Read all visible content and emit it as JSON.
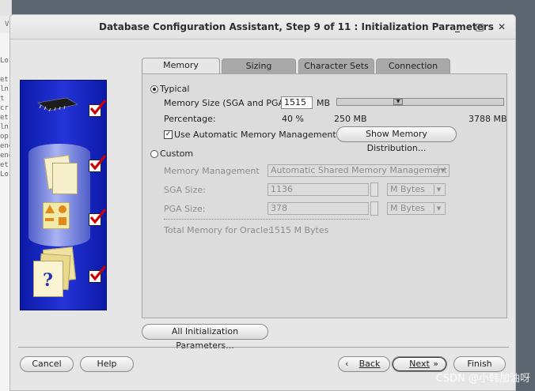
{
  "background_terminal": {
    "lines": [
      "et",
      "ln",
      "t",
      "cr",
      "et",
      "ln",
      "op",
      "ene",
      "ene",
      "et",
      "Lo"
    ],
    "top_labels": [
      "V",
      "Lo"
    ]
  },
  "window": {
    "title": "Database Configuration Assistant, Step 9 of 11 : Initialization Parameters",
    "minimize": "_",
    "maximize": "□",
    "close": "✕"
  },
  "tabs": [
    {
      "label": "Memory",
      "active": true
    },
    {
      "label": "Sizing",
      "active": false
    },
    {
      "label": "Character Sets",
      "active": false
    },
    {
      "label": "Connection Mode",
      "active": false
    }
  ],
  "memory": {
    "typical_label": "Typical",
    "typical_selected": true,
    "memory_size_label": "Memory Size (SGA and PGA):",
    "memory_size_value": "1515",
    "memory_size_unit": "MB",
    "percentage_label": "Percentage:",
    "percentage_value": "40 %",
    "slider_min": "250 MB",
    "slider_max": "3788 MB",
    "slider_fraction": 0.36,
    "use_amm_label": "Use Automatic Memory Management",
    "use_amm_checked": true,
    "show_distribution_button": "Show Memory Distribution...",
    "custom_label": "Custom",
    "custom_selected": false,
    "memory_management_label": "Memory Management",
    "memory_management_value": "Automatic Shared Memory Management",
    "sga_label": "SGA Size:",
    "sga_value": "1136",
    "sga_unit": "M Bytes",
    "pga_label": "PGA Size:",
    "pga_value": "378",
    "pga_unit": "M Bytes",
    "total_label": "Total Memory for Oracle:",
    "total_value": "1515 M Bytes"
  },
  "all_params_button": "All Initialization Parameters...",
  "footer": {
    "cancel": "Cancel",
    "help": "Help",
    "back": "Back",
    "next": "Next",
    "finish": "Finish",
    "back_arrow": "‹",
    "next_arrow": "»"
  },
  "watermark": "CSDN @小韩加油呀",
  "colors": {
    "sidebar_blue": "#1a27c4",
    "check_red": "#cc0000"
  },
  "sidebar_icons": [
    "chip-icon",
    "database-icon",
    "shapes-icon",
    "question-documents-icon"
  ]
}
